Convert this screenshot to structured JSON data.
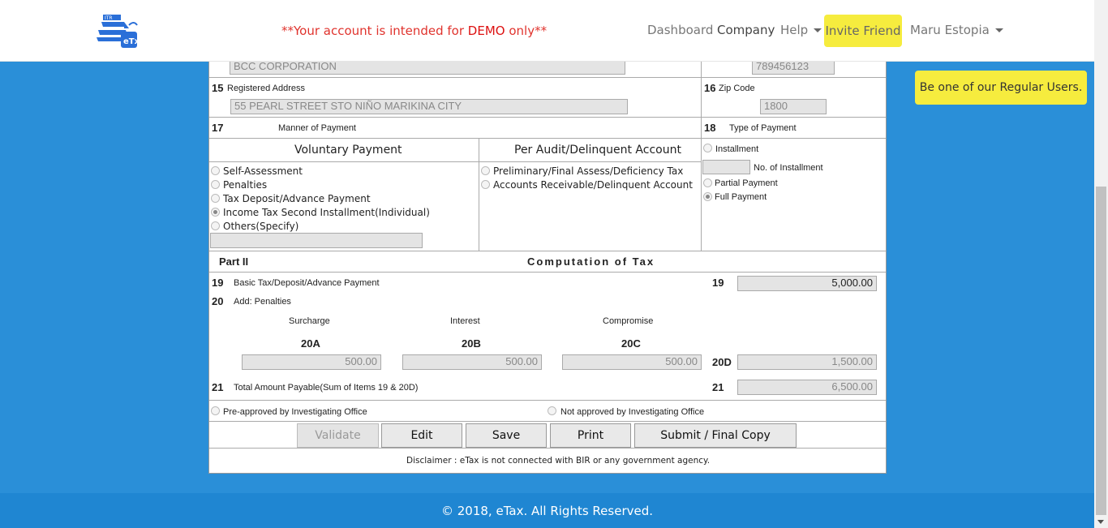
{
  "nav": {
    "demo_prefix": "**Your account is intended for ",
    "demo_word": "DEMO",
    "demo_suffix": " only**",
    "dashboard": "Dashboard",
    "company": "Company",
    "help": "Help",
    "invite": "Invite Friend",
    "user": "Maru Estopia",
    "logo_text": "eTx",
    "logo_badge": "ITR"
  },
  "banner": "Be one of our Regular Users.",
  "form": {
    "company_name": "BCC CORPORATION",
    "tin": "789456123",
    "item15_num": "15",
    "item15_label": "Registered Address",
    "address": "55 PEARL STREET STO NIÑO MARIKINA CITY",
    "item16_num": "16",
    "item16_label": "Zip Code",
    "zip": "1800",
    "item17_num": "17",
    "item17_label": "Manner of Payment",
    "item18_num": "18",
    "item18_label": "Type of Payment",
    "voluntary_header": "Voluntary Payment",
    "audit_header": "Per Audit/Delinquent Account",
    "voluntary_options": [
      "Self-Assessment",
      "Penalties",
      "Tax Deposit/Advance Payment",
      "Income Tax Second Installment(Individual)",
      "Others(Specify)"
    ],
    "audit_options": [
      "Preliminary/Final Assess/Deficiency Tax",
      "Accounts Receivable/Delinquent Account"
    ],
    "installment_label": "Installment",
    "no_installment_label": "No. of Installment",
    "partial_label": "Partial Payment",
    "full_label": "Full Payment",
    "part2": "Part II",
    "computation_title": "Computation of Tax",
    "item19_num": "19",
    "item19_label": "Basic Tax/Deposit/Advance Payment",
    "item19_value": "5,000.00",
    "item20_num": "20",
    "item20_label": "Add: Penalties",
    "surcharge_label": "Surcharge",
    "interest_label": "Interest",
    "compromise_label": "Compromise",
    "code_20a": "20A",
    "code_20b": "20B",
    "code_20c": "20C",
    "code_20d": "20D",
    "value_20a": "500.00",
    "value_20b": "500.00",
    "value_20c": "500.00",
    "value_20d": "1,500.00",
    "item21_num": "21",
    "item21_label": "Total Amount Payable(Sum of Items 19 & 20D)",
    "item21_value": "6,500.00",
    "preapproved_label": "Pre-approved by Investigating Office",
    "notapproved_label": "Not approved by Investigating Office",
    "disclaimer": "Disclaimer : eTax is not connected with BIR or any government agency."
  },
  "buttons": {
    "validate": "Validate",
    "edit": "Edit",
    "save": "Save",
    "print": "Print",
    "submit": "Submit / Final Copy"
  },
  "footer": "© 2018, eTax. All Rights Reserved.",
  "colors": {
    "background": "#2a8fd8",
    "footer": "#1f86d2",
    "accent_yellow": "#f6ec3e",
    "demo_red": "#e0332d",
    "logo_blue": "#2a6fd8"
  }
}
